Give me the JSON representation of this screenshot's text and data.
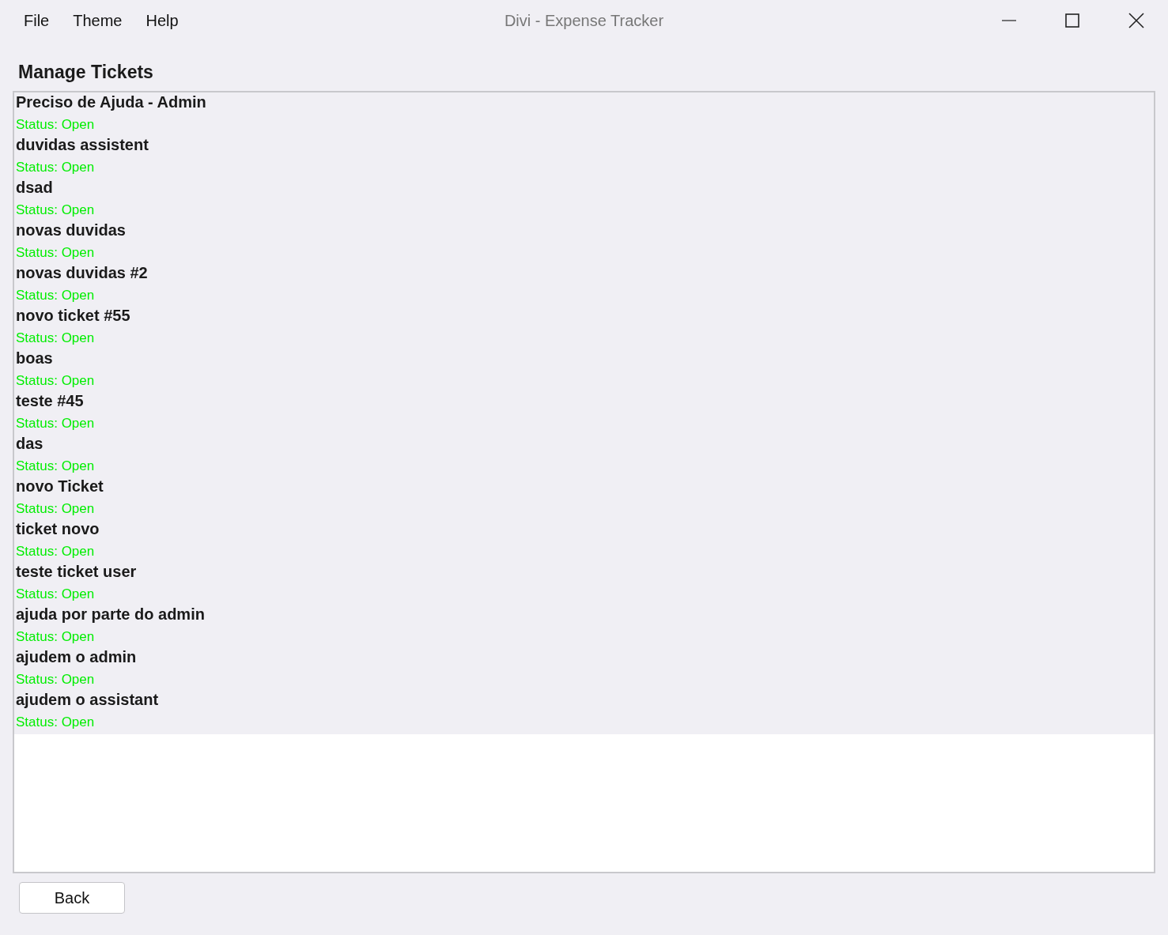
{
  "menu": [
    "File",
    "Theme",
    "Help"
  ],
  "window": {
    "title": "Divi - Expense Tracker"
  },
  "heading": "Manage Tickets",
  "tickets": [
    {
      "title": "Preciso de Ajuda - Admin",
      "status": "Status: Open"
    },
    {
      "title": "duvidas assistent",
      "status": "Status: Open"
    },
    {
      "title": "dsad",
      "status": "Status: Open"
    },
    {
      "title": "novas duvidas",
      "status": "Status: Open"
    },
    {
      "title": "novas duvidas #2",
      "status": "Status: Open"
    },
    {
      "title": "novo ticket #55",
      "status": "Status: Open"
    },
    {
      "title": "boas",
      "status": "Status: Open"
    },
    {
      "title": "teste #45",
      "status": "Status: Open"
    },
    {
      "title": "das",
      "status": "Status: Open"
    },
    {
      "title": "novo Ticket",
      "status": "Status: Open"
    },
    {
      "title": "ticket novo",
      "status": "Status: Open"
    },
    {
      "title": "teste ticket user",
      "status": "Status: Open"
    },
    {
      "title": "ajuda por parte do admin",
      "status": "Status: Open"
    },
    {
      "title": "ajudem o admin",
      "status": "Status: Open"
    },
    {
      "title": "ajudem o assistant",
      "status": "Status: Open"
    }
  ],
  "back_button": "Back"
}
